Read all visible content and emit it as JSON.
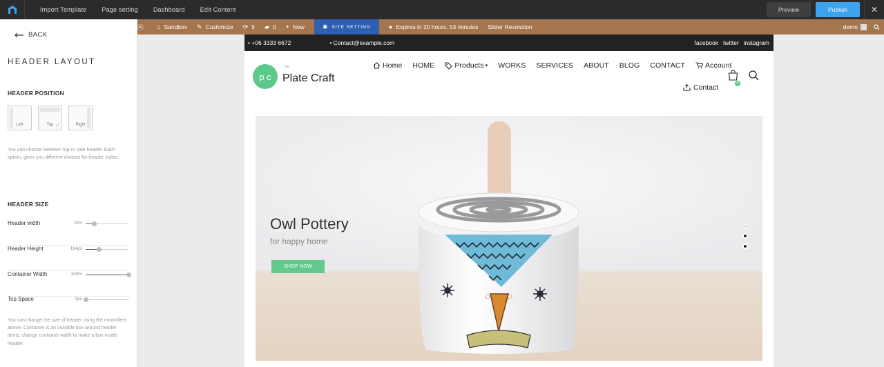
{
  "topbar": {
    "menu": [
      "Import Template",
      "Page setting",
      "Dashboard",
      "Edit Content"
    ],
    "preview_label": "Preview",
    "publish_label": "Publish",
    "close_label": "✕"
  },
  "panel": {
    "back_label": "BACK",
    "title": "HEADER LAYOUT",
    "position_heading": "HEADER POSITION",
    "position_options": [
      "Left",
      "Top",
      "Right"
    ],
    "position_selected": "Top",
    "position_help": "You can choose between top or side header. Each option, gives you different choices for header styles.",
    "size_heading": "HEADER SIZE",
    "controls": [
      {
        "label": "Header width",
        "value": "70%",
        "level": 0.2
      },
      {
        "label": "Header Height",
        "value": "114px",
        "level": 0.3
      },
      {
        "label": "Container Width",
        "value": "100%",
        "level": 1.0
      },
      {
        "label": "Top Space",
        "value": "0px",
        "level": 0.0
      }
    ],
    "size_help": "You can change the size of header using the controllers above. Container is an invisible box around header items, change container width to make a box inside header."
  },
  "adminbar": {
    "sandbox": "Sandbox",
    "customize": "Customize",
    "updates": "5",
    "comments": "0",
    "new": "New",
    "site_setting": "SITE SETTING",
    "expires": "Expires in 20 hours, 53 minutes",
    "slider": "Slider Revolution",
    "user": "demo"
  },
  "site": {
    "phone": "+06 3333 6672",
    "email": "Contact@example.com",
    "social": [
      "facebook",
      "twitter",
      "instagram"
    ],
    "logo_initials": "p c",
    "logo_tm": "TM",
    "brand_name": "Plate Craft",
    "nav": {
      "home_icon": "Home",
      "home": "HOME",
      "products": "Products",
      "works": "WORKS",
      "services": "SERVICES",
      "about": "ABOUT",
      "blog": "BLOG",
      "contact": "CONTACT",
      "account": "Account",
      "contact2": "Contact"
    },
    "cart_count": "0",
    "hero": {
      "title": "Owl Pottery",
      "subtitle": "for happy home",
      "button": "SHOP NOW"
    }
  },
  "colors": {
    "accent": "#5cc98a",
    "publish": "#3ea3ee",
    "adminbar": "#a5754e",
    "site_setting": "#2f5fb0"
  }
}
